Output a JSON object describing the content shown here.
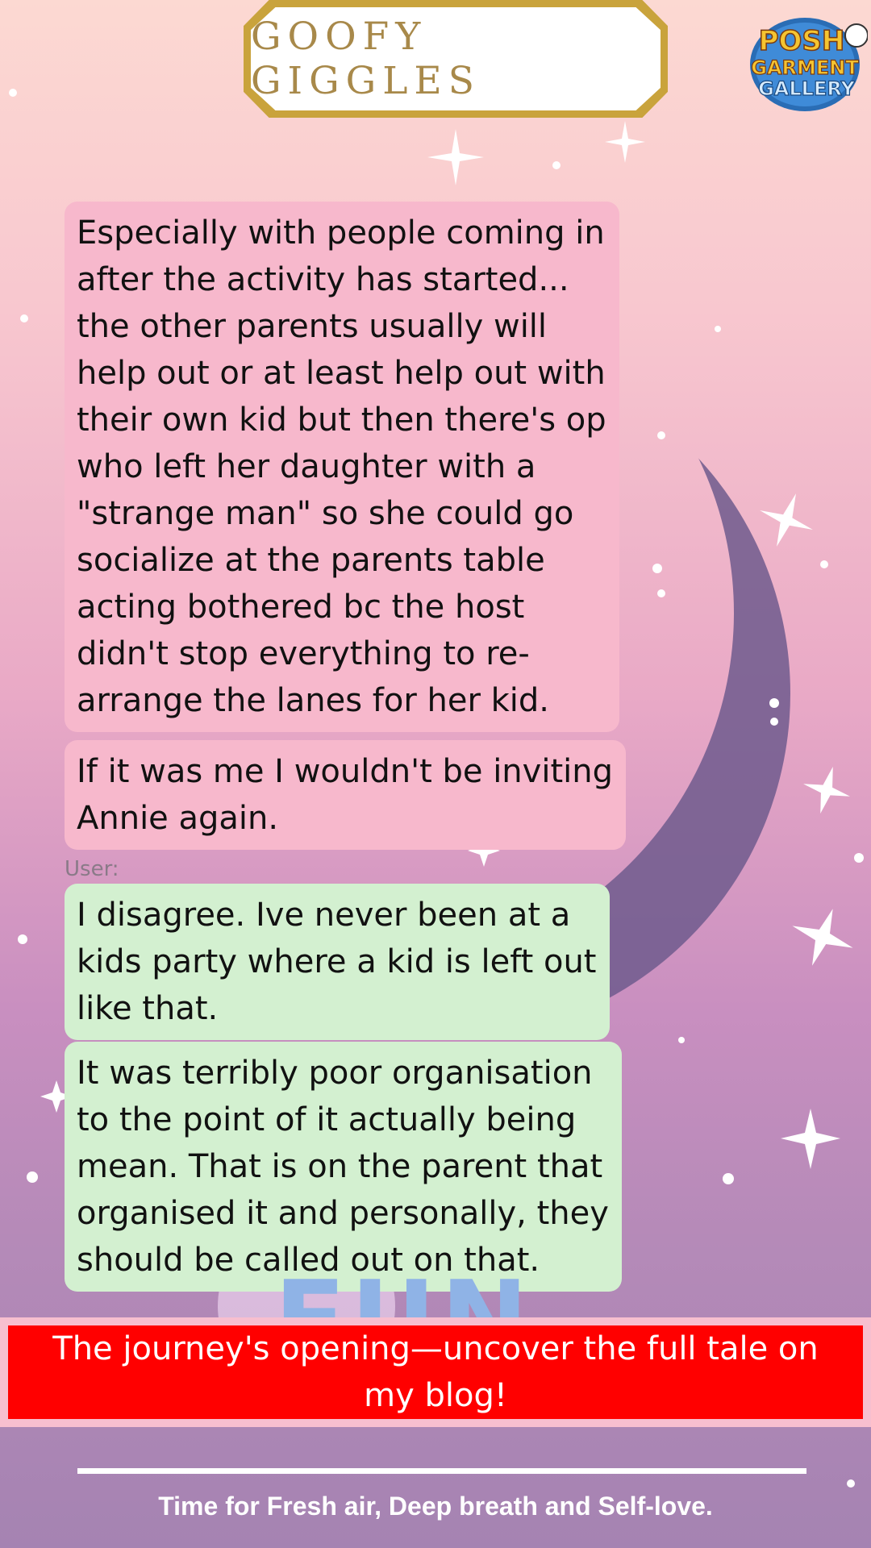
{
  "header": {
    "title": "GOOFY GIGGLES"
  },
  "logo": {
    "line1": "POSH",
    "line2": "GARMENT",
    "line3": "GALLERY"
  },
  "messages": [
    {
      "side": "other",
      "text": "Especially with people coming in after the activity has started... the other parents usually will help out or at least help out with their own kid but then there's op who left her daughter with a \"strange man\" so she could go socialize at the parents table acting bothered bc the host didn't stop everything to re-arrange the lanes for her kid."
    },
    {
      "side": "other",
      "text": "If it was me I wouldn't be inviting Annie again."
    },
    {
      "side": "user",
      "text": "I disagree. Ive never been at a kids party where a kid is left out like that."
    },
    {
      "side": "user",
      "text": "It was terribly poor organisation to the point of it actually being mean. That is on the parent that organised it and personally, they should be called out on that."
    }
  ],
  "sender_label": "User:",
  "background_art": {
    "fun_text": "FUN"
  },
  "banner": {
    "text": "The journey's opening—uncover the full tale on my blog!"
  },
  "footer": {
    "tagline": "Time for Fresh air, Deep breath and Self-love."
  },
  "colors": {
    "pink_bubble": "#f7b8cc",
    "green_bubble": "#d3f0d0",
    "banner": "#ff0000",
    "title_gold": "#c9a33c"
  }
}
